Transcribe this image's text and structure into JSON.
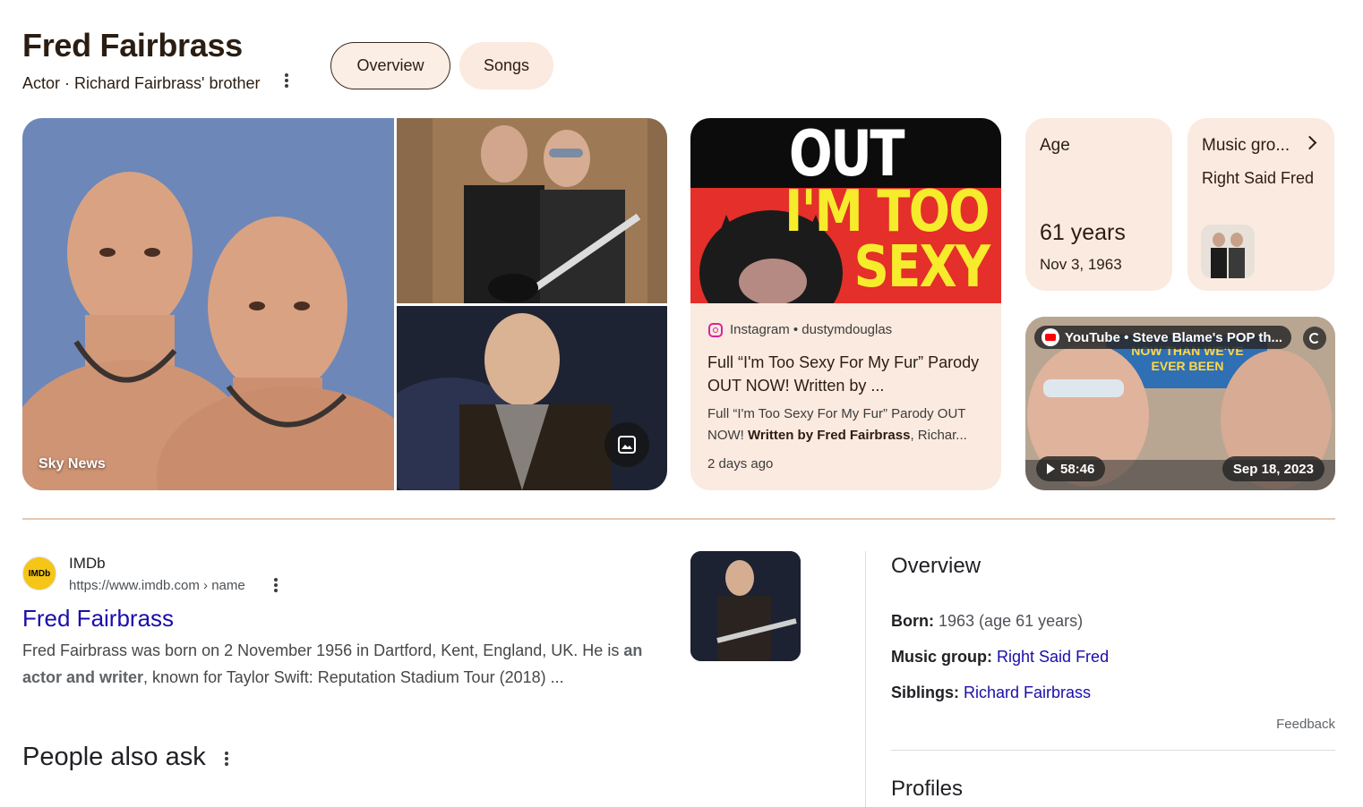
{
  "header": {
    "title": "Fred Fairbrass",
    "subtitle": "Actor · Richard Fairbrass' brother"
  },
  "tabs": [
    {
      "label": "Overview",
      "selected": true
    },
    {
      "label": "Songs",
      "selected": false
    }
  ],
  "images": {
    "main_source": "Sky News"
  },
  "post": {
    "thumb_line1": "OUT NOW",
    "thumb_line2": "I'M TOO",
    "thumb_line3": "SEXY",
    "source": "Instagram • dustymdouglas",
    "title": "Full “I'm Too Sexy For My Fur” Parody OUT NOW! Written by ...",
    "snippet_pre": "Full “I'm Too Sexy For My Fur” Parody OUT NOW! ",
    "snippet_bold": "Written by Fred Fairbrass",
    "snippet_post": ", Richar...",
    "time": "2 days ago"
  },
  "age_card": {
    "label": "Age",
    "value": "61 years",
    "date": "Nov 3, 1963"
  },
  "group_card": {
    "label": "Music gro...",
    "value": "Right Said Fred"
  },
  "video": {
    "source": "YouTube • Steve Blame's POP th...",
    "duration": "58:46",
    "date": "Sep 18, 2023",
    "overlay_line1": "NOW THAN WE'VE",
    "overlay_line2": "EVER BEEN"
  },
  "result": {
    "favicon_text": "IMDb",
    "site": "IMDb",
    "url": "https://www.imdb.com › name",
    "title": "Fred Fairbrass",
    "snippet_1": "Fred Fairbrass was born on 2 November 1956 in Dartford, Kent, England, UK. He is ",
    "snippet_bold": "an actor and writer",
    "snippet_2": ", known for Taylor Swift: Reputation Stadium Tour (2018) ..."
  },
  "people_also_ask": {
    "title": "People also ask"
  },
  "overview": {
    "title": "Overview",
    "born_label": "Born:",
    "born_value": "1963 (age 61 years)",
    "group_label": "Music group:",
    "group_value": "Right Said Fred",
    "siblings_label": "Siblings:",
    "siblings_value": "Richard Fairbrass",
    "feedback": "Feedback",
    "profiles_title": "Profiles"
  },
  "colors": {
    "card_bg": "#fbeadf",
    "link": "#1a0dab",
    "title_brown": "#2b1d12",
    "divider": "#e6c8b0"
  }
}
